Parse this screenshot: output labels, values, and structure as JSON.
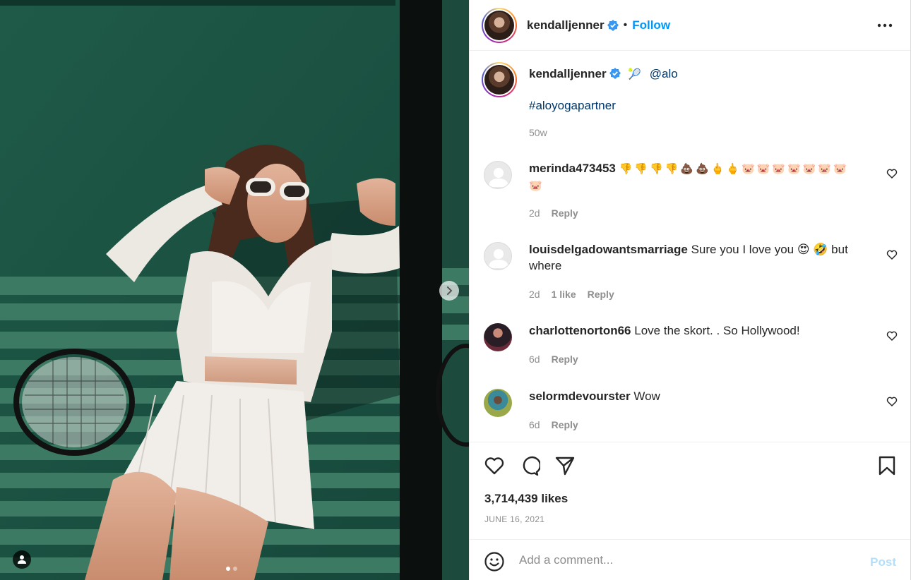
{
  "post": {
    "author": "kendalljenner",
    "follow_label": "Follow",
    "separator": "•",
    "caption_mention": "@alo",
    "caption_emoji": "🎾",
    "caption_hashtag": "#aloyogapartner",
    "caption_age": "50w",
    "likes": "3,714,439 likes",
    "date": "JUNE 16, 2021"
  },
  "comments": [
    {
      "user": "merinda473453",
      "text": "👎👎👎👎💩💩🖕🖕🐷🐷🐷🐷🐷🐷🐷🐷",
      "age": "2d",
      "likes": "",
      "reply": "Reply"
    },
    {
      "user": "louisdelgadowantsmarriage",
      "text": "Sure you I love you 😍 🤣 but where",
      "age": "2d",
      "likes": "1 like",
      "reply": "Reply"
    },
    {
      "user": "charlottenorton66",
      "text": "Love the skort. . So Hollywood!",
      "age": "6d",
      "likes": "",
      "reply": "Reply"
    },
    {
      "user": "selormdevourster",
      "text": "Wow",
      "age": "6d",
      "likes": "",
      "reply": "Reply"
    }
  ],
  "composer": {
    "placeholder": "Add a comment...",
    "post_label": "Post"
  },
  "carousel": {
    "current": 1,
    "total": 2
  },
  "icons": [
    "tag-user-icon",
    "chevron-right-icon",
    "verified-badge-icon",
    "more-options-icon",
    "heart-icon",
    "comment-icon",
    "share-icon",
    "bookmark-icon",
    "emoji-icon"
  ],
  "colors": {
    "accent": "#0095f6",
    "verified": "#3897f0",
    "text": "#262626",
    "muted": "#8e8e8e",
    "link": "#00376b"
  }
}
